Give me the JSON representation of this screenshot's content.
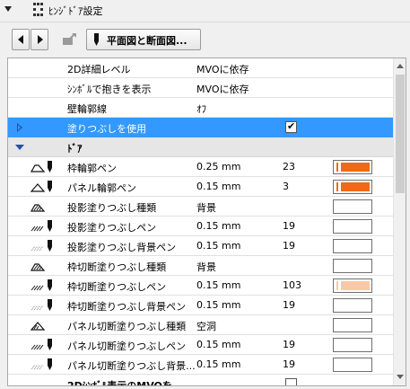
{
  "header": {
    "title": "ﾋﾝｼﾞﾄﾞｱ設定"
  },
  "toolbar": {
    "view_label": "平面図と断面図..."
  },
  "colors": {
    "selection": "#3399ff",
    "pen_orange": "#ee6a14",
    "pen_light": "#f8c9a6"
  },
  "rows": [
    {
      "name": "2D詳細レベル",
      "value": "MVOに依存"
    },
    {
      "name": "ｼﾝﾎﾞﾙで抱きを表示",
      "value": "MVOに依存"
    },
    {
      "name": "壁輪郭線",
      "value": "ｵﾌ"
    },
    {
      "name": "塗りつぶしを使用",
      "checked": true
    },
    {
      "name": "ﾄﾞｱ"
    },
    {
      "name": "枠輪郭ペン",
      "value": "0.25 mm",
      "pen": "23",
      "icon": "frame-contour-pen-icon"
    },
    {
      "name": "パネル輪郭ペン",
      "value": "0.15 mm",
      "pen": "3",
      "icon": "panel-contour-pen-icon"
    },
    {
      "name": "投影塗りつぶし種類",
      "value": "背景",
      "icon": "hatch-type-icon"
    },
    {
      "name": "投影塗りつぶしペン",
      "value": "0.15 mm",
      "pen": "19",
      "icon": "hatch-pen-icon"
    },
    {
      "name": "投影塗りつぶし背景ペン",
      "value": "0.15 mm",
      "pen": "19",
      "icon": "hatch-bg-pen-icon"
    },
    {
      "name": "枠切断塗りつぶし種類",
      "value": "背景",
      "icon": "hatch-type-icon"
    },
    {
      "name": "枠切断塗りつぶしペン",
      "value": "0.15 mm",
      "pen": "103",
      "icon": "hatch-pen-icon"
    },
    {
      "name": "枠切断塗りつぶし背景ペン",
      "value": "0.15 mm",
      "pen": "19",
      "icon": "hatch-bg-pen-icon"
    },
    {
      "name": "パネル切断塗りつぶし種類",
      "value": "空洞",
      "icon": "hatch-type-icon"
    },
    {
      "name": "パネル切断塗りつぶしペン",
      "value": "0.15 mm",
      "pen": "19",
      "icon": "hatch-pen-icon"
    },
    {
      "name": "パネル切断塗りつぶし背景...",
      "value": "0.15 mm",
      "pen": "19",
      "icon": "hatch-bg-pen-icon"
    },
    {
      "name": "2Dｼﾝﾎﾞﾙ表示のMVOを"
    }
  ]
}
